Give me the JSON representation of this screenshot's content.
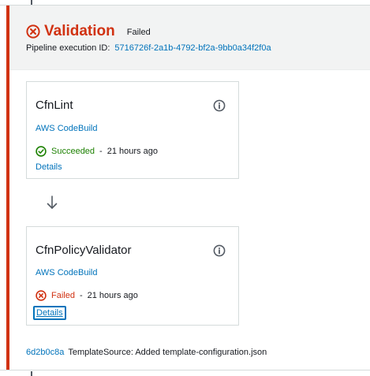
{
  "stage": {
    "name": "Validation",
    "status": "Failed",
    "execution_label": "Pipeline execution ID:",
    "execution_id": "5716726f-2a1b-4792-bf2a-9bb0a34f2f0a",
    "status_color": "#d13212"
  },
  "actions": [
    {
      "name": "CfnLint",
      "provider": "AWS CodeBuild",
      "status": "Succeeded",
      "separator": "-",
      "time": "21 hours ago",
      "details_label": "Details",
      "status_icon": "check-circle-icon",
      "status_color": "#1d8102"
    },
    {
      "name": "CfnPolicyValidator",
      "provider": "AWS CodeBuild",
      "status": "Failed",
      "separator": "-",
      "time": "21 hours ago",
      "details_label": "Details",
      "status_icon": "x-circle-icon",
      "status_color": "#d13212"
    }
  ],
  "commit": {
    "id": "6d2b0c8a",
    "message": "TemplateSource: Added template-configuration.json"
  },
  "icons": {
    "stage_status": "x-circle-icon",
    "info": "info-icon",
    "transition": "arrow-down-icon"
  },
  "colors": {
    "link": "#0073bb",
    "error": "#d13212",
    "success": "#1d8102",
    "header_bg": "#f2f3f3"
  }
}
